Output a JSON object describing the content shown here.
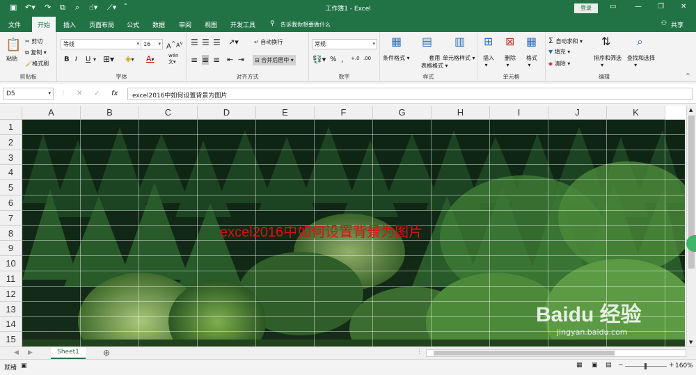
{
  "titlebar": {
    "title": "工作簿1 - Excel",
    "login": "登录",
    "share": "共享"
  },
  "tabs": [
    "文件",
    "开始",
    "插入",
    "页面布局",
    "公式",
    "数据",
    "审阅",
    "视图",
    "开发工具"
  ],
  "tellme": "告诉我你想要做什么",
  "ribbon": {
    "clipboard": {
      "paste": "粘贴",
      "cut": "剪切",
      "copy": "复制",
      "format_painter": "格式刷",
      "label": "剪贴板"
    },
    "font": {
      "name": "等线",
      "size": "16",
      "bold": "B",
      "italic": "I",
      "underline": "U",
      "label": "字体",
      "wen": "wén"
    },
    "align": {
      "wrap": "自动换行",
      "merge": "合并后居中",
      "label": "对齐方式"
    },
    "number": {
      "format": "常规",
      "percent": "%",
      "comma": ",",
      "label": "数字"
    },
    "styles": {
      "cond": "条件格式",
      "table1": "套用",
      "table2": "表格格式",
      "cell": "单元格样式",
      "label": "样式"
    },
    "cells": {
      "insert": "插入",
      "delete": "删除",
      "format": "格式",
      "label": "单元格"
    },
    "editing": {
      "autosum": "自动求和",
      "fill": "填充",
      "clear": "清除",
      "sort": "排序和筛选",
      "find": "查找和选择",
      "label": "编辑"
    }
  },
  "formula_bar": {
    "name_box": "D5",
    "fx": "fx",
    "content": "excel2016中如何设置背景为图片"
  },
  "columns": [
    "A",
    "B",
    "C",
    "D",
    "E",
    "F",
    "G",
    "H",
    "I",
    "J",
    "K"
  ],
  "rows": [
    "1",
    "2",
    "3",
    "4",
    "5",
    "6",
    "7",
    "8",
    "9",
    "10",
    "11",
    "12",
    "13",
    "14",
    "15"
  ],
  "cell_text": "excel2016中如何设置背景为图片",
  "sheet_tab": "Sheet1",
  "status": {
    "ready": "就绪",
    "zoom": "160%"
  },
  "watermark": "Baidu 经验",
  "watermark_url": "jingyan.baidu.com",
  "colors": {
    "accent": "#217346",
    "overlay_text": "#e01010"
  }
}
